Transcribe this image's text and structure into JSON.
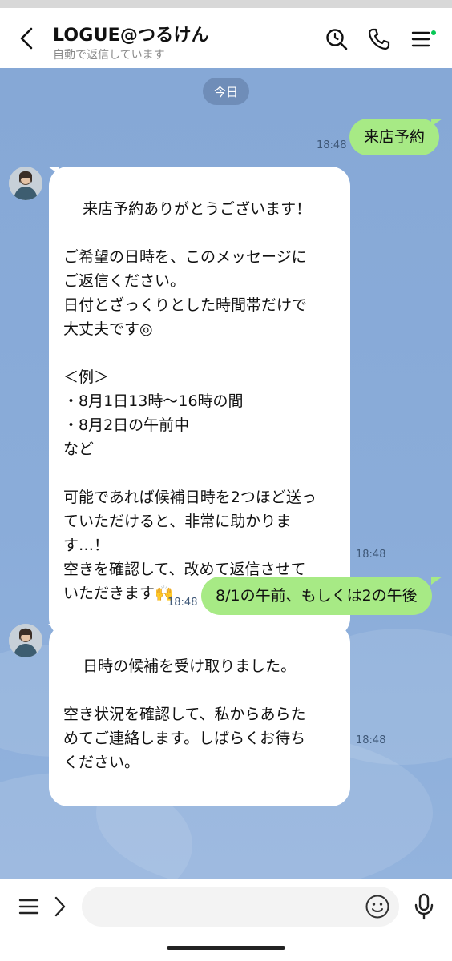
{
  "header": {
    "title": "LOGUE@つるけん",
    "subtitle": "自動で返信しています",
    "icons": [
      "back-icon",
      "search-icon",
      "phone-icon",
      "menu-icon"
    ]
  },
  "chat": {
    "date_label": "今日",
    "messages": [
      {
        "sender": "me",
        "text": "来店予約",
        "time": "18:48"
      },
      {
        "sender": "shop",
        "text": "来店予約ありがとうございます！\n\nご希望の日時を、このメッセージに\nご返信ください。\n日付とざっくりとした時間帯だけで\n大丈夫です◎\n\n＜例＞\n・8月1日13時〜16時の間\n・8月2日の午前中\nなど\n\n可能であれば候補日時を2つほど送っ\nていただけると、非常に助かりま\nす…！\n空きを確認して、改めて返信させて\nいただきます🙌",
        "time": "18:48"
      },
      {
        "sender": "me",
        "text": "8/1の午前、もしくは2の午後",
        "time": "18:48"
      },
      {
        "sender": "shop",
        "text": "日時の候補を受け取りました。\n\n空き状況を確認して、私からあらた\nめてご連絡します。しばらくお待ち\nください。",
        "time": "18:48"
      }
    ]
  },
  "input": {
    "value": "",
    "icons": [
      "menu-icon",
      "chevron-right-icon",
      "emoji-icon",
      "microphone-icon"
    ]
  },
  "colors": {
    "chat_background": "#8aacd9",
    "outgoing_bubble": "#a7ea85",
    "incoming_bubble": "#ffffff",
    "date_chip": "#6f8db8",
    "online_dot": "#06c755"
  }
}
